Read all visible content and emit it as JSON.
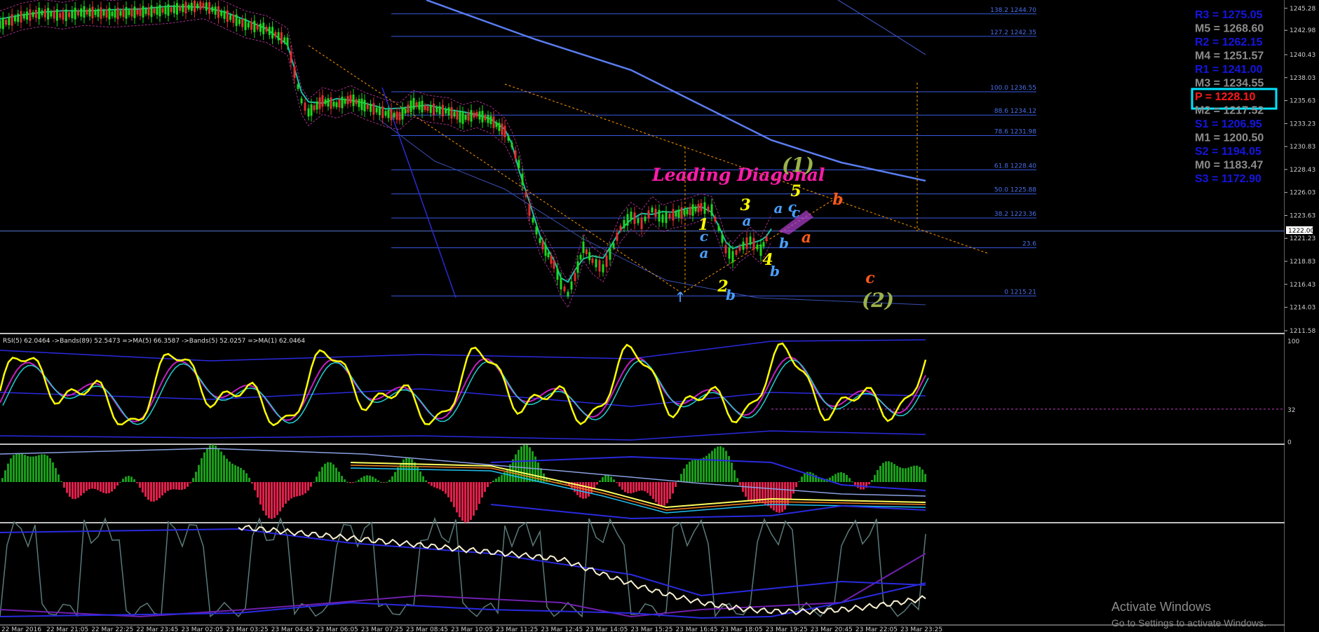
{
  "chart_data": [
    {
      "type": "line",
      "panel": "price",
      "title": "",
      "series_label": "",
      "ylim": [
        1211.58,
        1246.0
      ],
      "y_ticks": [
        "1245.28",
        "1242.98",
        "1240.43",
        "1238.03",
        "1235.63",
        "1233.23",
        "1230.83",
        "1228.43",
        "1226.03",
        "1223.63",
        "1221.23",
        "1218.83",
        "1216.43",
        "1214.03",
        "1211.58"
      ],
      "current_price": "1222.00",
      "fib_levels": [
        {
          "label": "138.2 1244.70",
          "value": 1244.7
        },
        {
          "label": "127.2 1242.35",
          "value": 1242.35
        },
        {
          "label": "100.0 1236.55",
          "value": 1236.55
        },
        {
          "label": "88.6 1234.12",
          "value": 1234.12
        },
        {
          "label": "78.6 1231.98",
          "value": 1231.98
        },
        {
          "label": "61.8 1228.40",
          "value": 1228.4
        },
        {
          "label": "50.0 1225.88",
          "value": 1225.88
        },
        {
          "label": "38.2 1223.36",
          "value": 1223.36
        },
        {
          "label": "23.6",
          "value": 1220.25
        },
        {
          "label": "0 1215.21",
          "value": 1215.21
        }
      ],
      "annotation": "Leading Diagonal",
      "wave_labels": [
        "(1)",
        "(2)",
        "1",
        "2",
        "3",
        "4",
        "5",
        "a",
        "b",
        "c",
        "a",
        "b",
        "c",
        "a",
        "b",
        "c",
        "a",
        "b",
        "c"
      ],
      "pivots": [
        {
          "label": "R3 = 1275.05",
          "color": "#1515e0"
        },
        {
          "label": "M5 = 1268.60",
          "color": "#8c8c8c"
        },
        {
          "label": "R2 = 1262.15",
          "color": "#1515e0"
        },
        {
          "label": "M4 = 1251.57",
          "color": "#8c8c8c"
        },
        {
          "label": "R1 = 1241.00",
          "color": "#1515e0"
        },
        {
          "label": "M3 = 1234.55",
          "color": "#8c8c8c"
        },
        {
          "label": "P  = 1228.10",
          "color": "#ff1a1a"
        },
        {
          "label": "M2 = 1217.52",
          "color": "#8c8c8c"
        },
        {
          "label": "S1 = 1206.95",
          "color": "#1515e0"
        },
        {
          "label": "M1 = 1200.50",
          "color": "#8c8c8c"
        },
        {
          "label": "S2 = 1194.05",
          "color": "#1515e0"
        },
        {
          "label": "M0 = 1183.47",
          "color": "#8c8c8c"
        },
        {
          "label": "S3 = 1172.90",
          "color": "#1515e0"
        }
      ],
      "price_path": [
        [
          0,
          1243.6
        ],
        [
          30,
          1244.4
        ],
        [
          60,
          1244.8
        ],
        [
          90,
          1244.5
        ],
        [
          120,
          1244.9
        ],
        [
          160,
          1244.7
        ],
        [
          200,
          1244.9
        ],
        [
          240,
          1245.1
        ],
        [
          290,
          1245.6
        ],
        [
          320,
          1244.6
        ],
        [
          350,
          1243.6
        ],
        [
          380,
          1243.1
        ],
        [
          410,
          1241.8
        ],
        [
          420,
          1238.6
        ],
        [
          430,
          1235.6
        ],
        [
          440,
          1234.4
        ],
        [
          460,
          1235.6
        ],
        [
          480,
          1235.2
        ],
        [
          500,
          1235.8
        ],
        [
          520,
          1235.1
        ],
        [
          550,
          1234.3
        ],
        [
          570,
          1234.0
        ],
        [
          590,
          1235.3
        ],
        [
          610,
          1234.8
        ],
        [
          640,
          1234.5
        ],
        [
          660,
          1233.8
        ],
        [
          680,
          1234.2
        ],
        [
          700,
          1233.6
        ],
        [
          720,
          1232.4
        ],
        [
          730,
          1231.0
        ],
        [
          740,
          1229.0
        ],
        [
          755,
          1224.2
        ],
        [
          770,
          1221.0
        ],
        [
          790,
          1218.5
        ],
        [
          800,
          1216.5
        ],
        [
          810,
          1215.4
        ],
        [
          820,
          1217.2
        ],
        [
          832,
          1220.3
        ],
        [
          845,
          1218.9
        ],
        [
          860,
          1218.1
        ],
        [
          870,
          1219.6
        ],
        [
          885,
          1222.3
        ],
        [
          900,
          1223.6
        ],
        [
          915,
          1222.8
        ],
        [
          930,
          1224.2
        ],
        [
          945,
          1223.3
        ],
        [
          960,
          1223.7
        ],
        [
          980,
          1224.0
        ],
        [
          1000,
          1224.5
        ],
        [
          1015,
          1224.2
        ],
        [
          1025,
          1222.3
        ],
        [
          1035,
          1220.1
        ],
        [
          1045,
          1219.3
        ],
        [
          1055,
          1220.2
        ],
        [
          1070,
          1221.0
        ],
        [
          1085,
          1220.0
        ],
        [
          1093,
          1221.2
        ],
        [
          1100,
          1222.3
        ]
      ]
    },
    {
      "type": "line",
      "panel": "rsi",
      "title": "RSI(5) 62.0464 ->Bands(89) 52.5473 =>MA(5) 66.3587 ->Bands(5) 52.0257 =>MA(1) 62.0464",
      "series_label": "",
      "ylim": [
        0,
        100
      ],
      "y_ticks": [
        "100",
        "32",
        "0"
      ],
      "level_line": 32
    },
    {
      "type": "bar",
      "panel": "histogram",
      "title": "",
      "series_label": "",
      "ylim": [
        -1,
        1
      ]
    },
    {
      "type": "line",
      "panel": "oscillator",
      "title": "",
      "series_label": "",
      "ylim": [
        0,
        1
      ]
    }
  ],
  "time_axis": [
    "22 Mar 2016",
    "22 Mar 21:05",
    "22 Mar 22:25",
    "22 Mar 23:45",
    "23 Mar 02:05",
    "23 Mar 03:25",
    "23 Mar 04:45",
    "23 Mar 06:05",
    "23 Mar 07:25",
    "23 Mar 08:45",
    "23 Mar 10:05",
    "23 Mar 11:25",
    "23 Mar 12:45",
    "23 Mar 14:05",
    "23 Mar 15:25",
    "23 Mar 16:45",
    "23 Mar 18:05",
    "23 Mar 19:25",
    "23 Mar 20:45",
    "23 Mar 22:05",
    "23 Mar 23:25"
  ],
  "watermark": {
    "title": "Activate Windows",
    "subtitle": "Go to Settings to activate Windows."
  },
  "colors": {
    "background": "#000000",
    "fib": "#4a6fe8",
    "rsi": "#ffff00",
    "bull": "#1a9e1a",
    "bear": "#e0204a",
    "pivot_box": "#00e5ff",
    "annotation": "#ff1ca8"
  }
}
